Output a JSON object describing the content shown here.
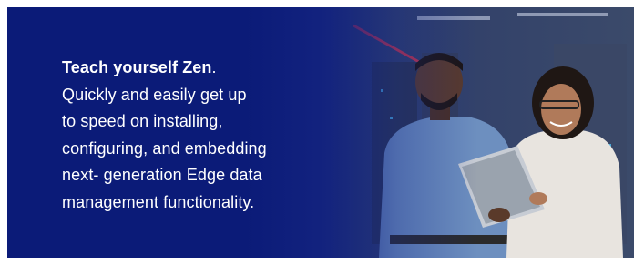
{
  "banner": {
    "headline": "Teach yourself Zen",
    "headline_punctuation": ".",
    "body_lines": [
      "Quickly and easily get up",
      "to speed on installing,",
      "configuring, and embedding",
      "next- generation Edge data",
      "management functionality."
    ]
  },
  "colors": {
    "brand_navy": "#0b1b78",
    "text": "#ffffff"
  },
  "image": {
    "subject": "two-people-with-tablet-in-server-room"
  }
}
